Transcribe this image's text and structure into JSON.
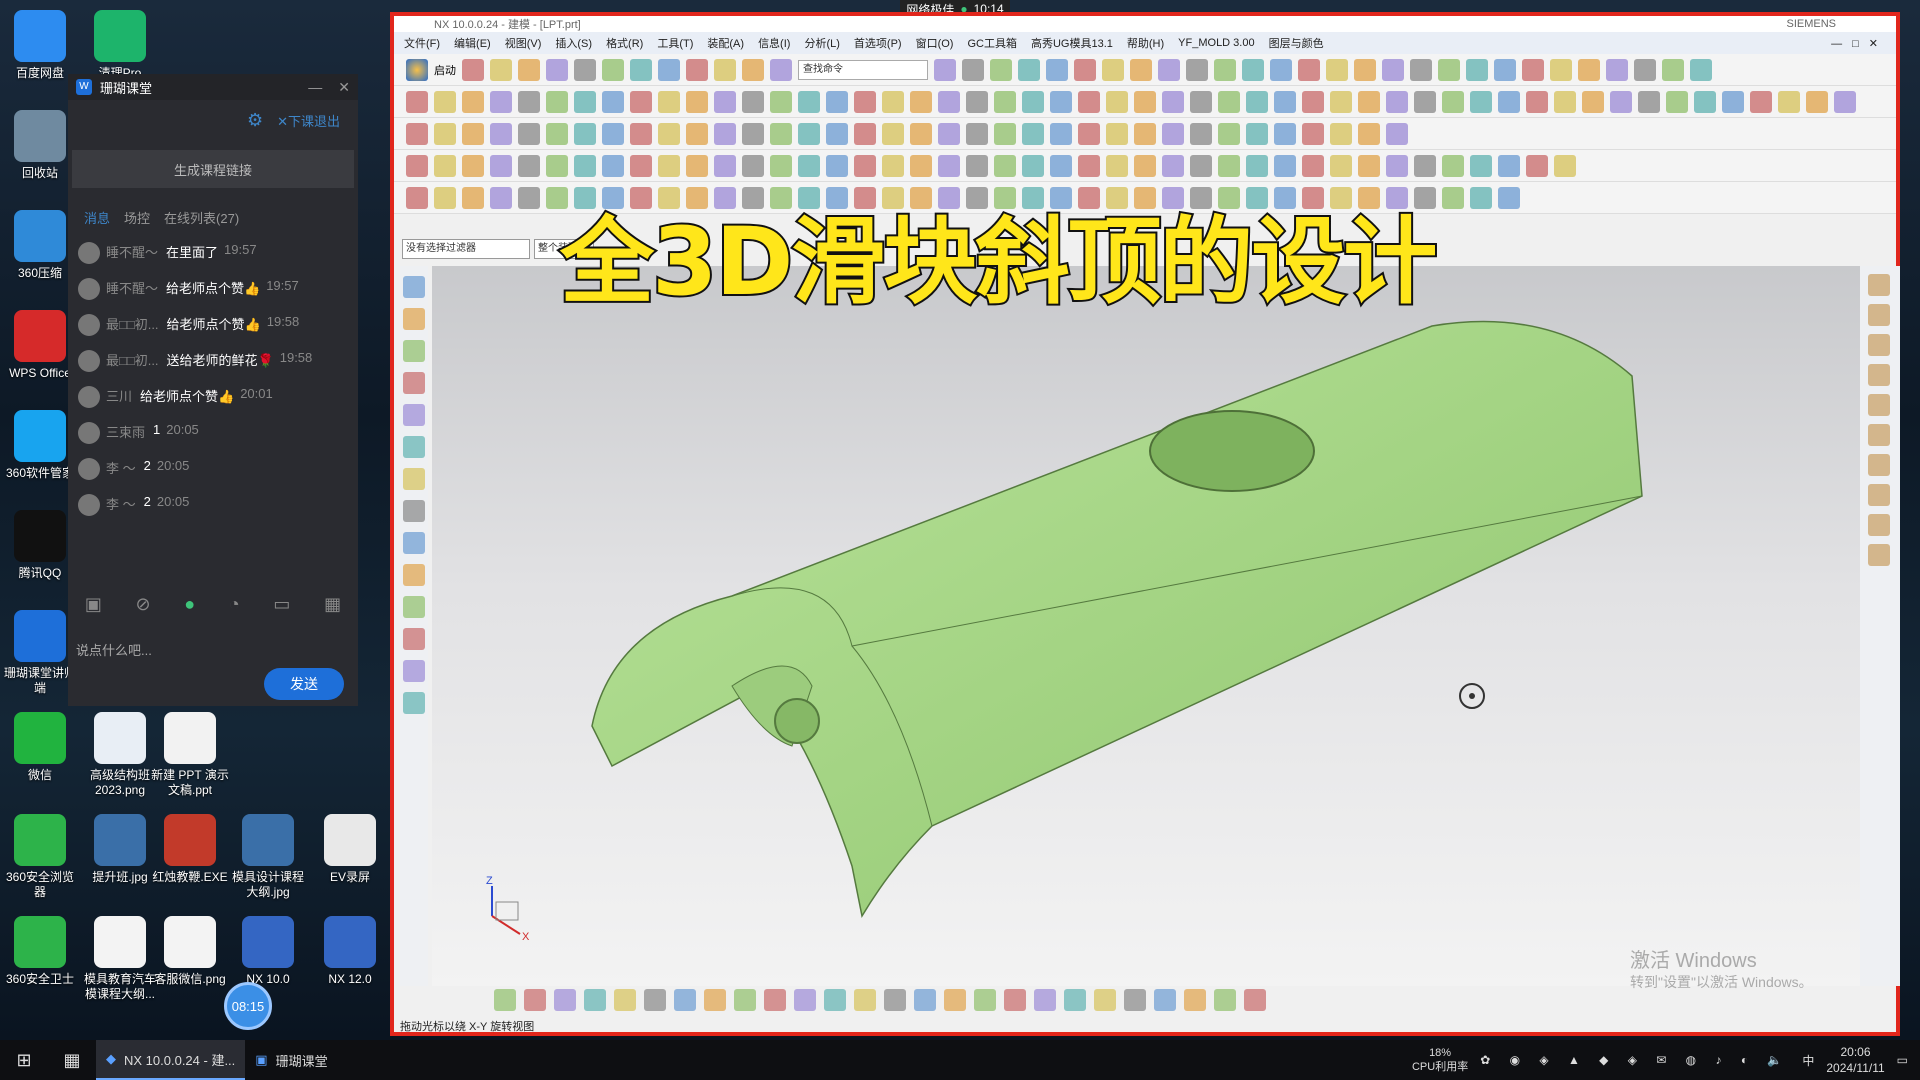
{
  "desktop_icons": [
    {
      "label": "百度网盘",
      "icon": "baidu-netdisk-icon",
      "color": "#2d8cf0"
    },
    {
      "label": "清理Pro",
      "icon": "clean-pro-icon",
      "color": "#1db46b"
    },
    {
      "label": "回收站",
      "icon": "recycle-bin-icon",
      "color": "#6f8aa0"
    },
    {
      "label": "360压缩",
      "icon": "360zip-icon",
      "color": "#2f8ad8"
    },
    {
      "label": "WPS Office",
      "icon": "wps-icon",
      "color": "#d62a2a"
    },
    {
      "label": "360软件管家",
      "icon": "360soft-icon",
      "color": "#18a4ef"
    },
    {
      "label": "腾讯QQ",
      "icon": "qq-icon",
      "color": "#111111"
    },
    {
      "label": "珊瑚课堂讲师端",
      "icon": "shanhu-icon",
      "color": "#1e6fd9"
    },
    {
      "label": "微信",
      "icon": "wechat-icon",
      "color": "#21b33f"
    },
    {
      "label": "高级结构班2023.png",
      "icon": "image-file-icon",
      "color": "#e8eef5"
    },
    {
      "label": "新建 PPT 演示文稿.ppt",
      "icon": "ppt-file-icon",
      "color": "#f2f2f2"
    },
    {
      "label": "360安全浏览器",
      "icon": "360browser-icon",
      "color": "#2db34a"
    },
    {
      "label": "提升班.jpg",
      "icon": "jpg-file-icon",
      "color": "#3a6fa8"
    },
    {
      "label": "红烛教鞭.EXE",
      "icon": "exe-icon",
      "color": "#c23a2a"
    },
    {
      "label": "模具设计课程大纲.jpg",
      "icon": "jpg-file-icon",
      "color": "#3a6fa8"
    },
    {
      "label": "EV录屏",
      "icon": "ev-recorder-icon",
      "color": "#e8e8e8"
    },
    {
      "label": "360安全卫士",
      "icon": "360safe-icon",
      "color": "#2db34a"
    },
    {
      "label": "模具教育汽车模课程大纲...",
      "icon": "doc-file-icon",
      "color": "#f3f3f3"
    },
    {
      "label": "客服微信.png",
      "icon": "qrcode-icon",
      "color": "#f3f3f3"
    },
    {
      "label": "NX 10.0",
      "icon": "nx10-icon",
      "color": "#3466c3"
    },
    {
      "label": "NX 12.0",
      "icon": "nx12-icon",
      "color": "#3466c3"
    }
  ],
  "chat": {
    "app_title": "珊瑚课堂",
    "exit_label": "下课退出",
    "gen_link_label": "生成课程链接",
    "tabs": [
      "消息",
      "场控",
      "在线列表(27)"
    ],
    "messages": [
      {
        "name": "睡不醒～",
        "text": "在里面了",
        "time": "19:57"
      },
      {
        "name": "睡不醒～",
        "text": "给老师点个赞👍",
        "time": "19:57"
      },
      {
        "name": "最□□初...",
        "text": "给老师点个赞👍",
        "time": "19:58"
      },
      {
        "name": "最□□初...",
        "text": "送给老师的鲜花🌹",
        "time": "19:58"
      },
      {
        "name": "三川",
        "text": "给老师点个赞👍",
        "time": "20:01"
      },
      {
        "name": "三束雨",
        "text": "1",
        "time": "20:05"
      },
      {
        "name": "李 ～",
        "text": "2",
        "time": "20:05"
      },
      {
        "name": "李 ～",
        "text": "2",
        "time": "20:05"
      }
    ],
    "input_placeholder": "说点什么吧...",
    "send_label": "发送"
  },
  "live_badge": {
    "label": "网络极佳",
    "time": "10:14"
  },
  "nx": {
    "title": "NX 10.0.0.24 - 建模 - [LPT.prt]",
    "brand": "SIEMENS",
    "menus": [
      "文件(F)",
      "编辑(E)",
      "视图(V)",
      "插入(S)",
      "格式(R)",
      "工具(T)",
      "装配(A)",
      "信息(I)",
      "分析(L)",
      "首选项(P)",
      "窗口(O)",
      "GC工具箱",
      "高秀UG模具13.1",
      "帮助(H)",
      "YF_MOLD 3.00",
      "图层与颜色"
    ],
    "start_label": "启动",
    "search_placeholder": "查找命令",
    "selection_filter": "没有选择过滤器",
    "assembly_filter": "整个装配",
    "status_text": "拖动光标以绕 X-Y 旋转视图",
    "overlay_title": "全3D滑块斜顶的设计",
    "model_color": "#a9d98a",
    "triad": {
      "z": "Z",
      "x": "X"
    }
  },
  "windows_activation": {
    "line1": "激活 Windows",
    "line2": "转到\"设置\"以激活 Windows。"
  },
  "taskbar": {
    "tasks": [
      {
        "label": "NX 10.0.0.24 - 建...",
        "icon": "nx-taskbar-icon",
        "active": true
      },
      {
        "label": "珊瑚课堂",
        "icon": "shanhu-taskbar-icon",
        "active": false
      }
    ],
    "cpu": "18%",
    "cpu_label": "CPU利用率",
    "ime": "中",
    "time": "20:06",
    "date": "2024/11/11",
    "timer_bubble": "08:15"
  }
}
